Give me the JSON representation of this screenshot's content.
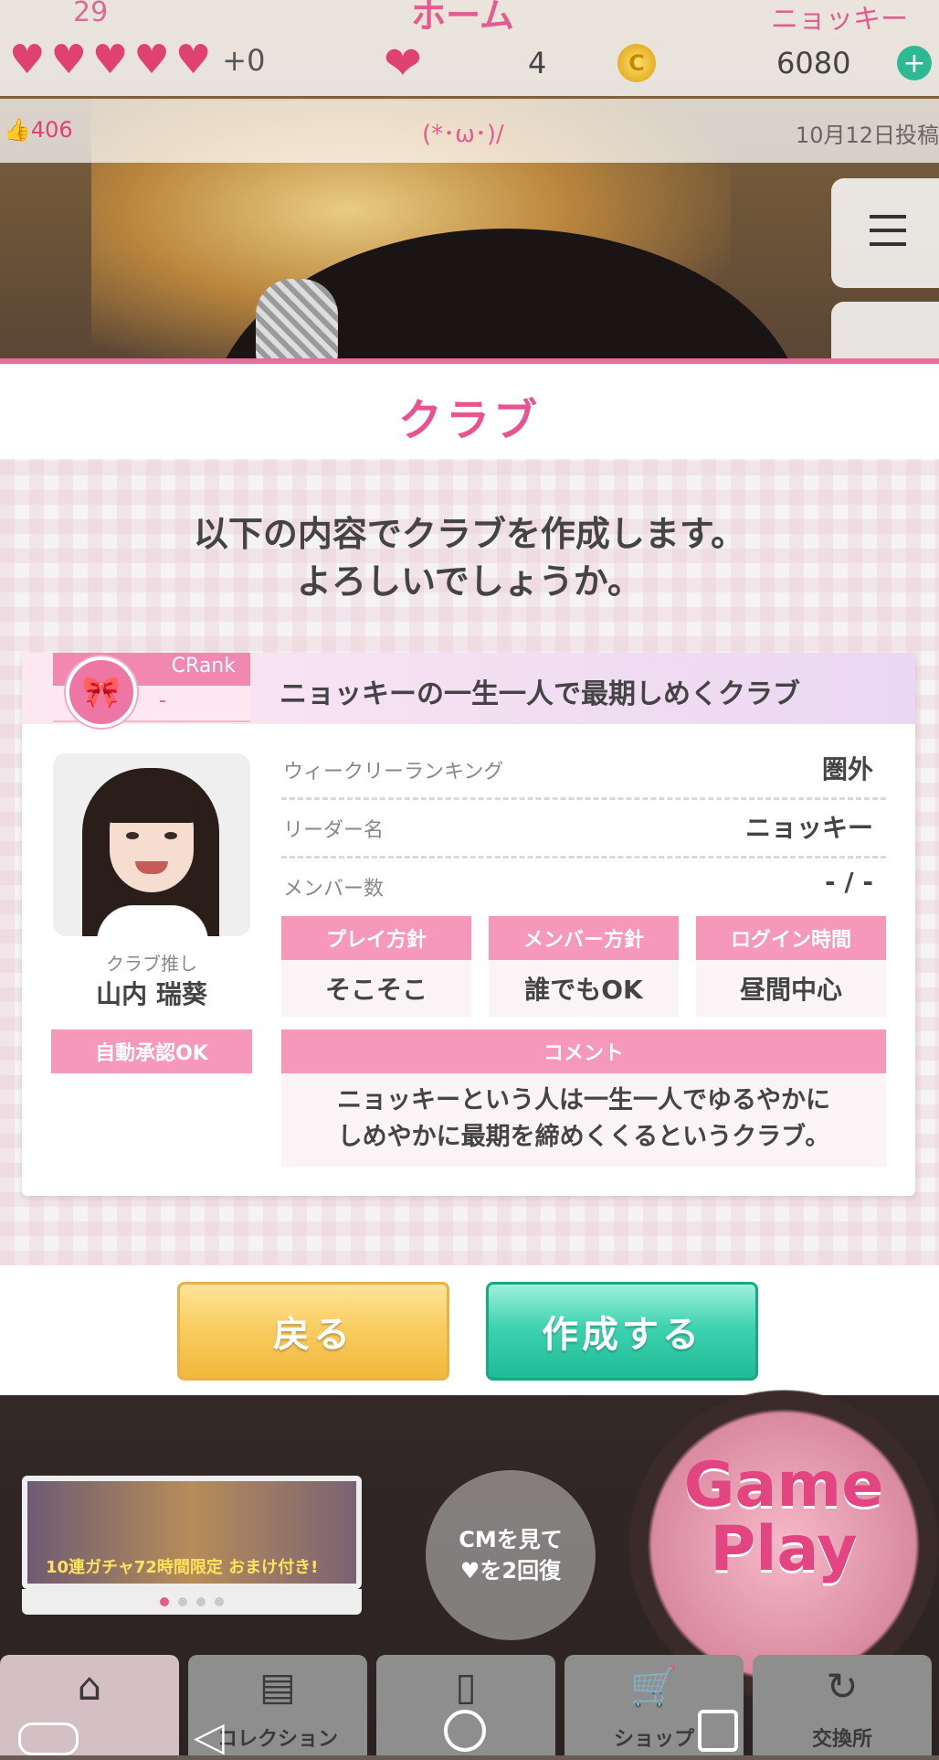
{
  "status_bar": {
    "level": "29",
    "screen_title": "ホーム",
    "player_name": "ニョッキー",
    "hearts_extra": "+0",
    "heart_count": "4",
    "coin_symbol": "C",
    "coin_count": "6080",
    "plus_label": "+"
  },
  "ticker": {
    "likes": "406",
    "emoticon": "(*･ω･)/",
    "post_date": "10月12日投稿"
  },
  "modal": {
    "title": "クラブ",
    "confirm_line1": "以下の内容でクラブを作成します。",
    "confirm_line2": "よろしいでしょうか。",
    "club": {
      "rank_label": "CRank",
      "rank_value": "-",
      "name": "ニョッキーの一生一人で最期しめくクラブ",
      "oshi_label": "クラブ推し",
      "oshi_name": "山内 瑞葵",
      "auto_approve": "自動承認OK",
      "rows": [
        {
          "label": "ウィークリーランキング",
          "value": "圏外"
        },
        {
          "label": "リーダー名",
          "value": "ニョッキー"
        },
        {
          "label": "メンバー数",
          "value": "- / -"
        }
      ],
      "policies": [
        {
          "label": "プレイ方針",
          "value": "そこそこ"
        },
        {
          "label": "メンバー方針",
          "value": "誰でもOK"
        },
        {
          "label": "ログイン時間",
          "value": "昼間中心"
        }
      ],
      "comment_label": "コメント",
      "comment_line1": "ニョッキーという人は一生一人でゆるやかに",
      "comment_line2": "しめやかに最期を締めくくるというクラブ。"
    },
    "back_button": "戻る",
    "create_button": "作成する"
  },
  "background": {
    "banner_text": "10連ガチャ72時間限定 おまけ付き!",
    "cm_line1": "CMを見て",
    "cm_line2": "♥を2回復",
    "game_play_line1": "Game",
    "game_play_line2": "Play",
    "nav_tabs": [
      {
        "label": "",
        "icon": "home-icon"
      },
      {
        "label": "コレクション",
        "icon": "book-icon"
      },
      {
        "label": "",
        "icon": "card-icon"
      },
      {
        "label": "ショップ",
        "icon": "cart-icon"
      },
      {
        "label": "交換所",
        "icon": "exchange-icon"
      }
    ]
  },
  "colors": {
    "accent_pink": "#e9538f",
    "label_pink": "#f598ba",
    "back_button": "#f9cd62",
    "create_button": "#3fd2b0"
  }
}
